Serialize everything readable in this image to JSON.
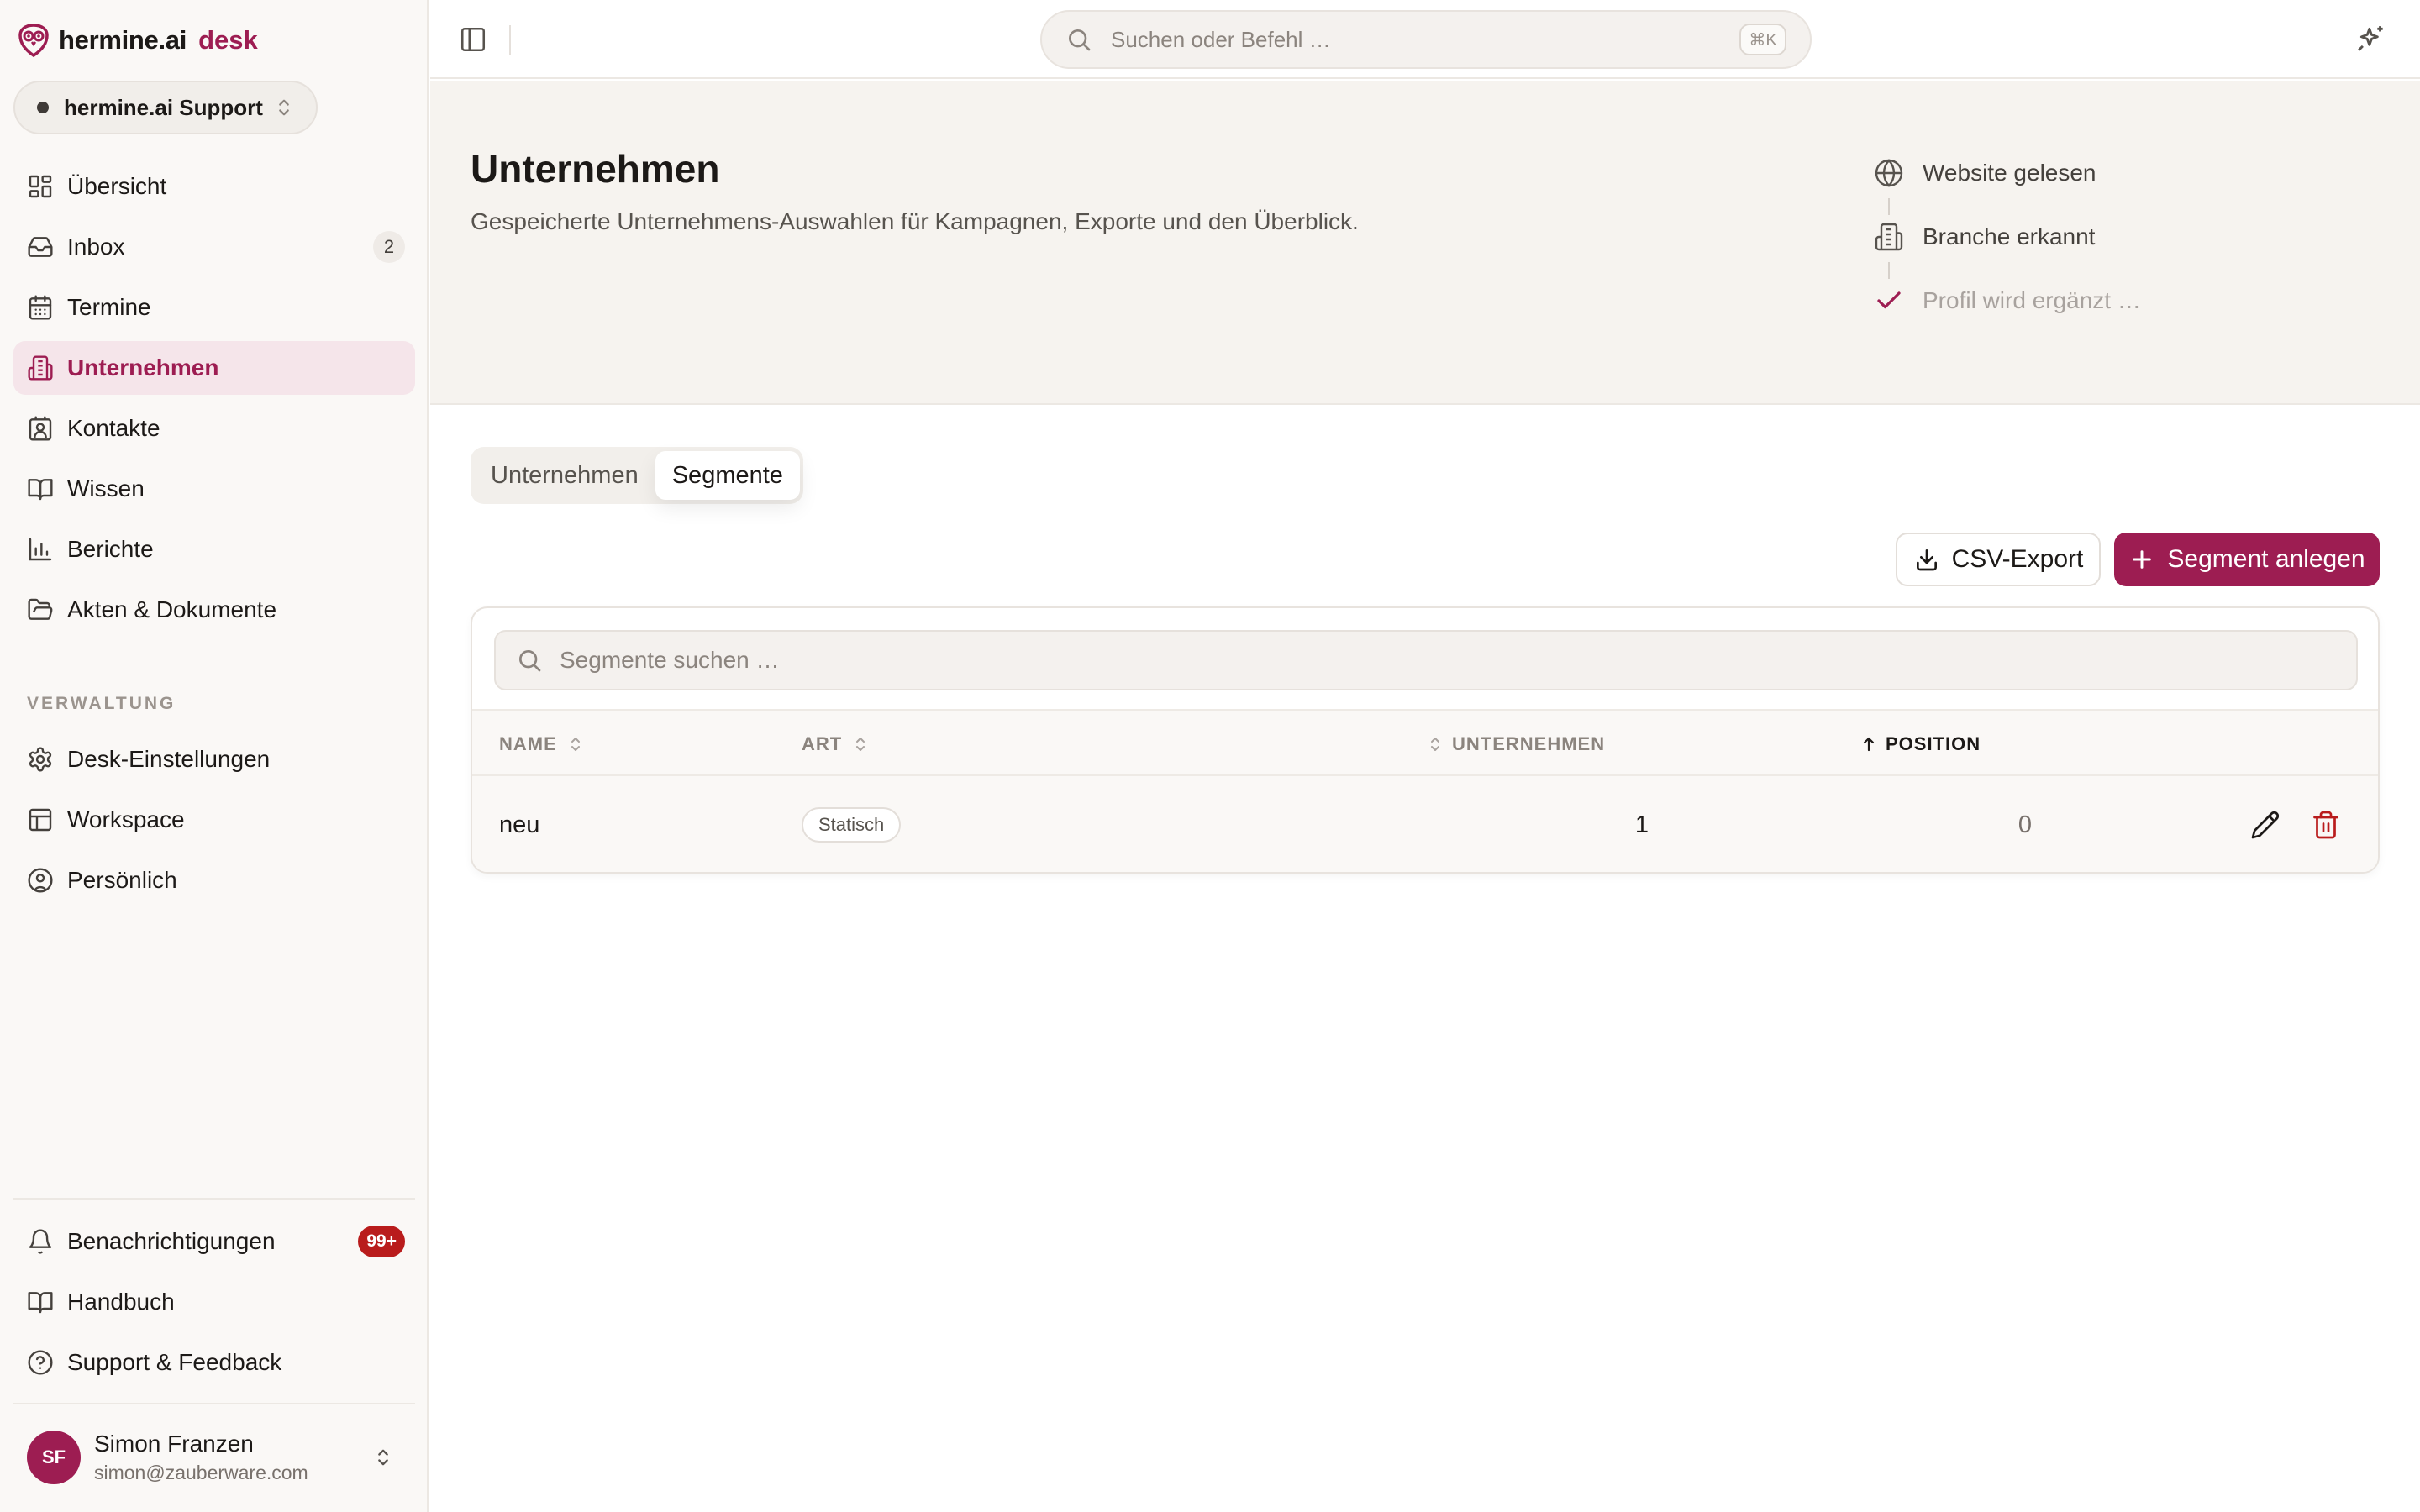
{
  "brand": {
    "name": "hermine.ai",
    "suffix": "desk",
    "accent": "#9d1d52"
  },
  "workspace": {
    "name": "hermine.ai Support"
  },
  "sidebar": {
    "items": [
      {
        "label": "Übersicht",
        "icon": "dashboard-icon"
      },
      {
        "label": "Inbox",
        "icon": "inbox-icon",
        "badge": "2"
      },
      {
        "label": "Termine",
        "icon": "calendar-icon"
      },
      {
        "label": "Unternehmen",
        "icon": "building-icon",
        "active": true
      },
      {
        "label": "Kontakte",
        "icon": "contact-icon"
      },
      {
        "label": "Wissen",
        "icon": "book-icon"
      },
      {
        "label": "Berichte",
        "icon": "bar-chart-icon"
      },
      {
        "label": "Akten & Dokumente",
        "icon": "folder-icon"
      }
    ],
    "section_label": "VERWALTUNG",
    "admin_items": [
      {
        "label": "Desk-Einstellungen",
        "icon": "gear-icon"
      },
      {
        "label": "Workspace",
        "icon": "layout-icon"
      },
      {
        "label": "Persönlich",
        "icon": "user-circle-icon"
      }
    ],
    "footer_items": [
      {
        "label": "Benachrichtigungen",
        "icon": "bell-icon",
        "badge": "99+"
      },
      {
        "label": "Handbuch",
        "icon": "book-icon"
      },
      {
        "label": "Support & Feedback",
        "icon": "help-circle-icon"
      }
    ]
  },
  "user": {
    "initials": "SF",
    "name": "Simon Franzen",
    "email": "simon@zauberware.com"
  },
  "topbar": {
    "search_placeholder": "Suchen oder Befehl …",
    "shortcut": "⌘K"
  },
  "page": {
    "title": "Unternehmen",
    "subtitle": "Gespeicherte Unternehmens-Auswahlen für Kampagnen, Exporte und den Überblick."
  },
  "steps": [
    {
      "label": "Website gelesen",
      "icon": "globe-icon",
      "state": "done"
    },
    {
      "label": "Branche erkannt",
      "icon": "building-icon",
      "state": "done"
    },
    {
      "label": "Profil wird ergänzt …",
      "icon": "check-icon",
      "state": "pending"
    }
  ],
  "tabs": [
    {
      "label": "Unternehmen",
      "active": false
    },
    {
      "label": "Segmente",
      "active": true
    }
  ],
  "actions": {
    "csv_label": "CSV-Export",
    "new_label": "Segment anlegen"
  },
  "table": {
    "search_placeholder": "Segmente suchen …",
    "columns": [
      "NAME",
      "ART",
      "UNTERNEHMEN",
      "POSITION"
    ],
    "sorted_column": "POSITION",
    "rows": [
      {
        "name": "neu",
        "type": "Statisch",
        "companies": "1",
        "position": "0"
      }
    ]
  }
}
